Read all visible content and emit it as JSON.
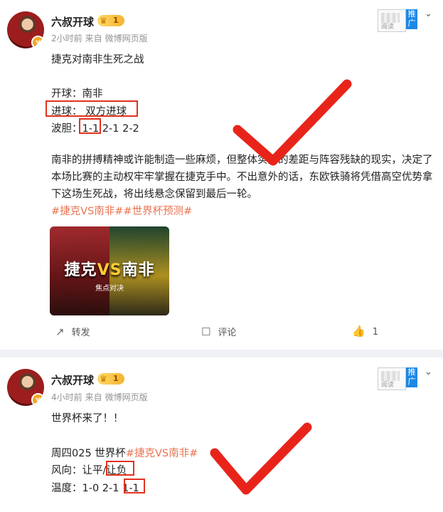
{
  "post1": {
    "author": "六叔开球",
    "level": "1",
    "time": "2小时前",
    "source_prefix": "来自",
    "source": "微博网页版",
    "read_label": "阅读",
    "promote_label": "推广",
    "title_line": "捷克对南非生死之战",
    "kickoff_label": "开球：",
    "kickoff_value": "南非",
    "goals_label": "进球：",
    "goals_value": "双方进球",
    "score_label": "波胆：",
    "score_values": [
      "1-1",
      "2-1",
      "2-2"
    ],
    "body": "南非的拼搏精神或许能制造一些麻烦，但整体实力的差距与阵容残缺的现实，决定了本场比赛的主动权牢牢掌握在捷克手中。不出意外的话，东欧铁骑将凭借高空优势拿下这场生死战，将出线悬念保留到最后一轮。",
    "hashtags": "#捷克VS南非##世界杯预测#",
    "image": {
      "title_left": "捷克",
      "title_vs": "VS",
      "title_right": "南非",
      "subtitle": "焦点对决"
    },
    "repost_label": "转发",
    "comment_label": "评论",
    "like_count": "1"
  },
  "post2": {
    "author": "六叔开球",
    "level": "1",
    "time": "4小时前",
    "source_prefix": "来自",
    "source": "微博网页版",
    "read_label": "阅读",
    "promote_label": "推广",
    "line1": "世界杯来了！！",
    "line2_prefix": "周四025 世界杯",
    "line2_tag": "#捷克VS南非#",
    "wind_label": "风向：",
    "wind_value1": "让平/",
    "wind_value2": "让负",
    "temp_label": "温度：",
    "temp_values": [
      "1-0",
      "2-1",
      "1-1"
    ]
  },
  "colors": {
    "accent_orange": "#eb7350",
    "check_red": "#e8241a",
    "promote_blue": "#1e88e5"
  }
}
